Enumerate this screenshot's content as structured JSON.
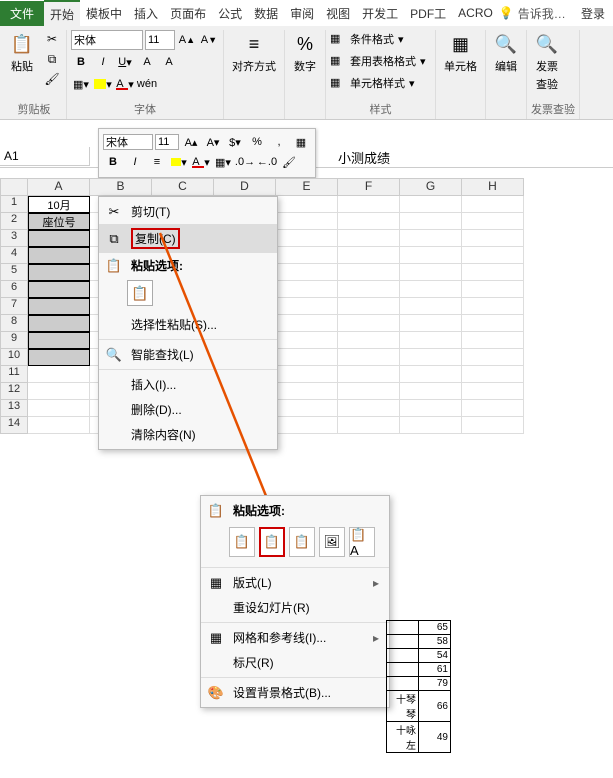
{
  "menubar": {
    "file": "文件",
    "tabs": [
      "开始",
      "模板中",
      "插入",
      "页面布",
      "公式",
      "数据",
      "审阅",
      "视图",
      "开发工",
      "PDF工",
      "ACRO"
    ],
    "tell": "告诉我…",
    "login": "登录"
  },
  "ribbon": {
    "clipboard": {
      "paste": "粘贴",
      "label": "剪贴板"
    },
    "font": {
      "name": "宋体",
      "size": "11",
      "label": "字体",
      "wen": "wén"
    },
    "align": {
      "label": "对齐方式"
    },
    "number": {
      "label": "数字",
      "pct": "%"
    },
    "styles": {
      "cond": "条件格式",
      "tbl": "套用表格格式",
      "cell": "单元格样式",
      "label": "样式"
    },
    "cells": {
      "label": "单元格"
    },
    "editing": {
      "label": "编辑"
    },
    "invoice": {
      "l1": "发票",
      "l2": "查验",
      "label": "发票查验"
    }
  },
  "namebox": "A1",
  "formula_partial": "小测成绩",
  "minitool": {
    "font": "宋体",
    "size": "11"
  },
  "grid": {
    "cols": [
      "A",
      "B",
      "C",
      "D",
      "E",
      "F",
      "G",
      "H"
    ],
    "rows": 14,
    "a1": "10月",
    "a2": "座位号"
  },
  "ctx1": {
    "cut": "剪切(T)",
    "copy": "复制(C)",
    "paste_hdr": "粘贴选项:",
    "paste_special": "选择性粘贴(S)...",
    "smart": "智能查找(L)",
    "insert": "插入(I)...",
    "delete": "删除(D)...",
    "clear": "清除内容(N)"
  },
  "ctx2": {
    "paste_hdr": "粘贴选项:",
    "layout": "版式(L)",
    "reset": "重设幻灯片(R)",
    "grid": "网格和参考线(I)...",
    "ruler": "标尺(R)",
    "bg": "设置背景格式(B)..."
  },
  "smalltable": {
    "rows": [
      [
        "",
        "65"
      ],
      [
        "",
        "58"
      ],
      [
        "",
        "54"
      ],
      [
        "",
        "61"
      ],
      [
        "",
        "79"
      ],
      [
        "十琴琴",
        "66"
      ],
      [
        "十咏左",
        "49"
      ]
    ]
  }
}
